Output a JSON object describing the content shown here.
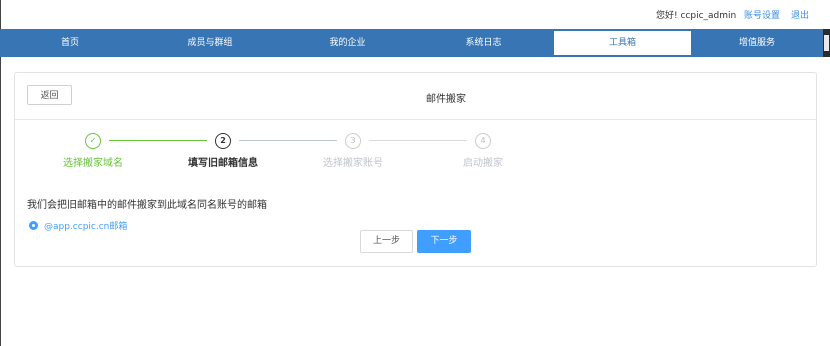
{
  "header": {
    "greeting": "您好! ccpic_admin",
    "account_settings": "账号设置",
    "logout": "退出"
  },
  "nav": {
    "items": [
      {
        "label": "首页"
      },
      {
        "label": "成员与群组"
      },
      {
        "label": "我的企业"
      },
      {
        "label": "系统日志"
      },
      {
        "label": "工具箱"
      },
      {
        "label": "增值服务"
      }
    ],
    "active_index": 4
  },
  "panel": {
    "back_label": "返回",
    "title": "邮件搬家"
  },
  "steps": [
    {
      "number": "✓",
      "label": "选择搬家域名",
      "state": "done"
    },
    {
      "number": "2",
      "label": "填写旧邮箱信息",
      "state": "current"
    },
    {
      "number": "3",
      "label": "选择搬家账号",
      "state": "todo"
    },
    {
      "number": "4",
      "label": "启动搬家",
      "state": "todo"
    }
  ],
  "description": "我们会把旧邮箱中的邮件搬家到此域名同名账号的邮箱",
  "radio_option": {
    "label": "@app.ccpic.cn邮箱",
    "selected": true
  },
  "buttons": {
    "prev": "上一步",
    "next": "下一步"
  },
  "colors": {
    "nav_bg": "#3775b5",
    "primary": "#409eff",
    "success": "#67c23a",
    "link": "#3a8ee6"
  }
}
